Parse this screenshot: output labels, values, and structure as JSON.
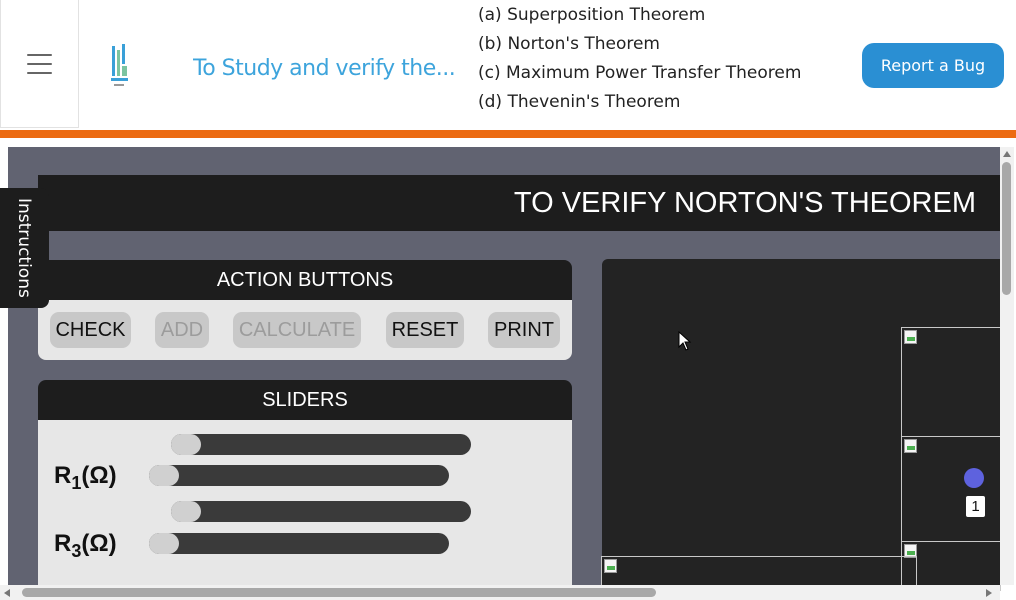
{
  "header": {
    "menu_icon": "hamburger-menu-icon",
    "app_title": "To Study and verify the...",
    "experiments": [
      "(a) Superposition Theorem",
      "(b) Norton's Theorem",
      "(c) Maximum Power Transfer Theorem",
      "(d) Thevenin's Theorem"
    ],
    "report_button": "Report a Bug"
  },
  "instructions_tab": "Instructions",
  "simulation": {
    "title": "TO VERIFY NORTON'S THEOREM",
    "action_panel": {
      "heading": "ACTION BUTTONS",
      "buttons": {
        "check": "CHECK",
        "add": "ADD",
        "calculate": "CALCULATE",
        "reset": "RESET",
        "print": "PRINT"
      }
    },
    "slider_panel": {
      "heading": "SLIDERS",
      "r1_label": "R",
      "r1_sub": "1",
      "r1_unit": "(Ω)",
      "r3_label": "R",
      "r3_sub": "3",
      "r3_unit": "(Ω)"
    },
    "canvas": {
      "node_label": "1"
    }
  },
  "colors": {
    "accent_blue": "#2a8fd3",
    "title_blue": "#3da4dc",
    "orange_bar": "#ec6b12",
    "sim_background": "#616371",
    "panel_dark": "#1d1d1d",
    "node_purple": "#5e62de"
  }
}
